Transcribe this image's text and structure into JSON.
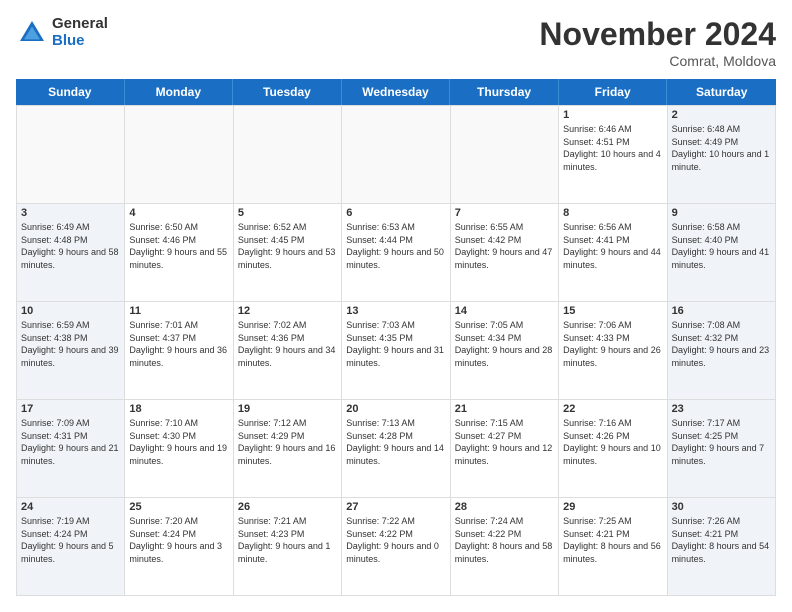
{
  "logo": {
    "general": "General",
    "blue": "Blue"
  },
  "title": "November 2024",
  "location": "Comrat, Moldova",
  "days_of_week": [
    "Sunday",
    "Monday",
    "Tuesday",
    "Wednesday",
    "Thursday",
    "Friday",
    "Saturday"
  ],
  "weeks": [
    [
      {
        "day": "",
        "info": ""
      },
      {
        "day": "",
        "info": ""
      },
      {
        "day": "",
        "info": ""
      },
      {
        "day": "",
        "info": ""
      },
      {
        "day": "",
        "info": ""
      },
      {
        "day": "1",
        "info": "Sunrise: 6:46 AM\nSunset: 4:51 PM\nDaylight: 10 hours and 4 minutes."
      },
      {
        "day": "2",
        "info": "Sunrise: 6:48 AM\nSunset: 4:49 PM\nDaylight: 10 hours and 1 minute."
      }
    ],
    [
      {
        "day": "3",
        "info": "Sunrise: 6:49 AM\nSunset: 4:48 PM\nDaylight: 9 hours and 58 minutes."
      },
      {
        "day": "4",
        "info": "Sunrise: 6:50 AM\nSunset: 4:46 PM\nDaylight: 9 hours and 55 minutes."
      },
      {
        "day": "5",
        "info": "Sunrise: 6:52 AM\nSunset: 4:45 PM\nDaylight: 9 hours and 53 minutes."
      },
      {
        "day": "6",
        "info": "Sunrise: 6:53 AM\nSunset: 4:44 PM\nDaylight: 9 hours and 50 minutes."
      },
      {
        "day": "7",
        "info": "Sunrise: 6:55 AM\nSunset: 4:42 PM\nDaylight: 9 hours and 47 minutes."
      },
      {
        "day": "8",
        "info": "Sunrise: 6:56 AM\nSunset: 4:41 PM\nDaylight: 9 hours and 44 minutes."
      },
      {
        "day": "9",
        "info": "Sunrise: 6:58 AM\nSunset: 4:40 PM\nDaylight: 9 hours and 41 minutes."
      }
    ],
    [
      {
        "day": "10",
        "info": "Sunrise: 6:59 AM\nSunset: 4:38 PM\nDaylight: 9 hours and 39 minutes."
      },
      {
        "day": "11",
        "info": "Sunrise: 7:01 AM\nSunset: 4:37 PM\nDaylight: 9 hours and 36 minutes."
      },
      {
        "day": "12",
        "info": "Sunrise: 7:02 AM\nSunset: 4:36 PM\nDaylight: 9 hours and 34 minutes."
      },
      {
        "day": "13",
        "info": "Sunrise: 7:03 AM\nSunset: 4:35 PM\nDaylight: 9 hours and 31 minutes."
      },
      {
        "day": "14",
        "info": "Sunrise: 7:05 AM\nSunset: 4:34 PM\nDaylight: 9 hours and 28 minutes."
      },
      {
        "day": "15",
        "info": "Sunrise: 7:06 AM\nSunset: 4:33 PM\nDaylight: 9 hours and 26 minutes."
      },
      {
        "day": "16",
        "info": "Sunrise: 7:08 AM\nSunset: 4:32 PM\nDaylight: 9 hours and 23 minutes."
      }
    ],
    [
      {
        "day": "17",
        "info": "Sunrise: 7:09 AM\nSunset: 4:31 PM\nDaylight: 9 hours and 21 minutes."
      },
      {
        "day": "18",
        "info": "Sunrise: 7:10 AM\nSunset: 4:30 PM\nDaylight: 9 hours and 19 minutes."
      },
      {
        "day": "19",
        "info": "Sunrise: 7:12 AM\nSunset: 4:29 PM\nDaylight: 9 hours and 16 minutes."
      },
      {
        "day": "20",
        "info": "Sunrise: 7:13 AM\nSunset: 4:28 PM\nDaylight: 9 hours and 14 minutes."
      },
      {
        "day": "21",
        "info": "Sunrise: 7:15 AM\nSunset: 4:27 PM\nDaylight: 9 hours and 12 minutes."
      },
      {
        "day": "22",
        "info": "Sunrise: 7:16 AM\nSunset: 4:26 PM\nDaylight: 9 hours and 10 minutes."
      },
      {
        "day": "23",
        "info": "Sunrise: 7:17 AM\nSunset: 4:25 PM\nDaylight: 9 hours and 7 minutes."
      }
    ],
    [
      {
        "day": "24",
        "info": "Sunrise: 7:19 AM\nSunset: 4:24 PM\nDaylight: 9 hours and 5 minutes."
      },
      {
        "day": "25",
        "info": "Sunrise: 7:20 AM\nSunset: 4:24 PM\nDaylight: 9 hours and 3 minutes."
      },
      {
        "day": "26",
        "info": "Sunrise: 7:21 AM\nSunset: 4:23 PM\nDaylight: 9 hours and 1 minute."
      },
      {
        "day": "27",
        "info": "Sunrise: 7:22 AM\nSunset: 4:22 PM\nDaylight: 9 hours and 0 minutes."
      },
      {
        "day": "28",
        "info": "Sunrise: 7:24 AM\nSunset: 4:22 PM\nDaylight: 8 hours and 58 minutes."
      },
      {
        "day": "29",
        "info": "Sunrise: 7:25 AM\nSunset: 4:21 PM\nDaylight: 8 hours and 56 minutes."
      },
      {
        "day": "30",
        "info": "Sunrise: 7:26 AM\nSunset: 4:21 PM\nDaylight: 8 hours and 54 minutes."
      }
    ]
  ]
}
